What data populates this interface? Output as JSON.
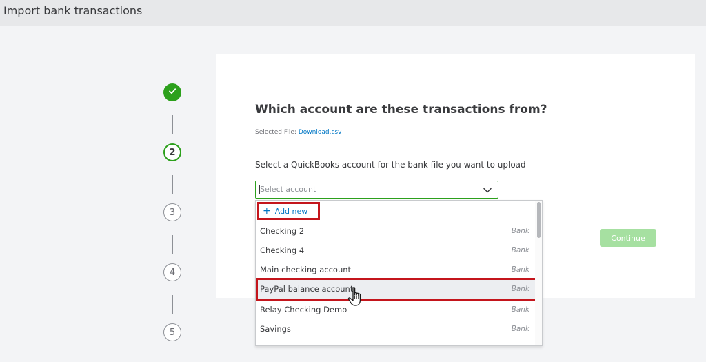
{
  "window": {
    "title": "Import bank transactions"
  },
  "stepper": {
    "steps": [
      {
        "label": "",
        "state": "done"
      },
      {
        "label": "2",
        "state": "active"
      },
      {
        "label": "3",
        "state": "future"
      },
      {
        "label": "4",
        "state": "future"
      },
      {
        "label": "5",
        "state": "future"
      }
    ]
  },
  "main": {
    "heading": "Which account are these transactions from?",
    "selected_file_label": "Selected File:",
    "selected_file_name": "Download.csv",
    "prompt": "Select a QuickBooks account for the bank file you want to upload",
    "select": {
      "placeholder": "Select account"
    },
    "continue_label": "Continue"
  },
  "dropdown": {
    "add_new_label": "Add new",
    "items": [
      {
        "name": "Checking 2",
        "type": "Bank"
      },
      {
        "name": "Checking 4",
        "type": "Bank"
      },
      {
        "name": "Main checking account",
        "type": "Bank"
      },
      {
        "name": "PayPal balance account",
        "type": "Bank"
      },
      {
        "name": "Relay Checking Demo",
        "type": "Bank"
      },
      {
        "name": "Savings",
        "type": "Bank"
      }
    ]
  },
  "colors": {
    "accent_green": "#2ca01c",
    "link_blue": "#0077c5",
    "highlight_red": "#c4151c"
  },
  "icons": [
    "checkmark-icon",
    "chevron-down-icon",
    "plus-icon",
    "hand-pointer-icon"
  ]
}
